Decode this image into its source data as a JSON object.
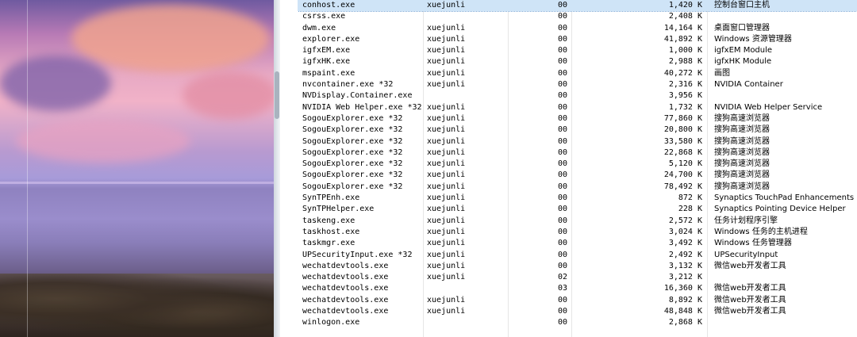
{
  "processes": [
    {
      "name": "conhost.exe",
      "user": "xuejunli",
      "cpu": "00",
      "mem": "1,420 K",
      "desc": "控制台窗口主机"
    },
    {
      "name": "csrss.exe",
      "user": "",
      "cpu": "00",
      "mem": "2,408 K",
      "desc": ""
    },
    {
      "name": "dwm.exe",
      "user": "xuejunli",
      "cpu": "00",
      "mem": "14,164 K",
      "desc": "桌面窗口管理器"
    },
    {
      "name": "explorer.exe",
      "user": "xuejunli",
      "cpu": "00",
      "mem": "41,892 K",
      "desc": "Windows 资源管理器"
    },
    {
      "name": "igfxEM.exe",
      "user": "xuejunli",
      "cpu": "00",
      "mem": "1,000 K",
      "desc": "igfxEM Module"
    },
    {
      "name": "igfxHK.exe",
      "user": "xuejunli",
      "cpu": "00",
      "mem": "2,988 K",
      "desc": "igfxHK Module"
    },
    {
      "name": "mspaint.exe",
      "user": "xuejunli",
      "cpu": "00",
      "mem": "40,272 K",
      "desc": "画图"
    },
    {
      "name": "nvcontainer.exe *32",
      "user": "xuejunli",
      "cpu": "00",
      "mem": "2,316 K",
      "desc": "NVIDIA Container"
    },
    {
      "name": "NVDisplay.Container.exe",
      "user": "",
      "cpu": "00",
      "mem": "3,956 K",
      "desc": ""
    },
    {
      "name": "NVIDIA Web Helper.exe *32",
      "user": "xuejunli",
      "cpu": "00",
      "mem": "1,732 K",
      "desc": "NVIDIA Web Helper Service"
    },
    {
      "name": "SogouExplorer.exe *32",
      "user": "xuejunli",
      "cpu": "00",
      "mem": "77,860 K",
      "desc": "搜狗高速浏览器"
    },
    {
      "name": "SogouExplorer.exe *32",
      "user": "xuejunli",
      "cpu": "00",
      "mem": "20,800 K",
      "desc": "搜狗高速浏览器"
    },
    {
      "name": "SogouExplorer.exe *32",
      "user": "xuejunli",
      "cpu": "00",
      "mem": "33,580 K",
      "desc": "搜狗高速浏览器"
    },
    {
      "name": "SogouExplorer.exe *32",
      "user": "xuejunli",
      "cpu": "00",
      "mem": "22,868 K",
      "desc": "搜狗高速浏览器"
    },
    {
      "name": "SogouExplorer.exe *32",
      "user": "xuejunli",
      "cpu": "00",
      "mem": "5,120 K",
      "desc": "搜狗高速浏览器"
    },
    {
      "name": "SogouExplorer.exe *32",
      "user": "xuejunli",
      "cpu": "00",
      "mem": "24,700 K",
      "desc": "搜狗高速浏览器"
    },
    {
      "name": "SogouExplorer.exe *32",
      "user": "xuejunli",
      "cpu": "00",
      "mem": "78,492 K",
      "desc": "搜狗高速浏览器"
    },
    {
      "name": "SynTPEnh.exe",
      "user": "xuejunli",
      "cpu": "00",
      "mem": "872 K",
      "desc": "Synaptics TouchPad Enhancements"
    },
    {
      "name": "SynTPHelper.exe",
      "user": "xuejunli",
      "cpu": "00",
      "mem": "228 K",
      "desc": "Synaptics Pointing Device Helper"
    },
    {
      "name": "taskeng.exe",
      "user": "xuejunli",
      "cpu": "00",
      "mem": "2,572 K",
      "desc": "任务计划程序引擎"
    },
    {
      "name": "taskhost.exe",
      "user": "xuejunli",
      "cpu": "00",
      "mem": "3,024 K",
      "desc": "Windows 任务的主机进程"
    },
    {
      "name": "taskmgr.exe",
      "user": "xuejunli",
      "cpu": "00",
      "mem": "3,492 K",
      "desc": "Windows 任务管理器"
    },
    {
      "name": "UPSecurityInput.exe *32",
      "user": "xuejunli",
      "cpu": "00",
      "mem": "2,492 K",
      "desc": "UPSecurityInput"
    },
    {
      "name": "wechatdevtools.exe",
      "user": "xuejunli",
      "cpu": "00",
      "mem": "3,132 K",
      "desc": "微信web开发者工具"
    },
    {
      "name": "wechatdevtools.exe",
      "user": "xuejunli",
      "cpu": "02",
      "mem": "3,212 K",
      "desc": ""
    },
    {
      "name": "wechatdevtools.exe",
      "user": "",
      "cpu": "03",
      "mem": "16,360 K",
      "desc": "微信web开发者工具"
    },
    {
      "name": "wechatdevtools.exe",
      "user": "xuejunli",
      "cpu": "00",
      "mem": "8,892 K",
      "desc": "微信web开发者工具"
    },
    {
      "name": "wechatdevtools.exe",
      "user": "xuejunli",
      "cpu": "00",
      "mem": "48,848 K",
      "desc": "微信web开发者工具"
    },
    {
      "name": "winlogon.exe",
      "user": "",
      "cpu": "00",
      "mem": "2,868 K",
      "desc": ""
    }
  ]
}
